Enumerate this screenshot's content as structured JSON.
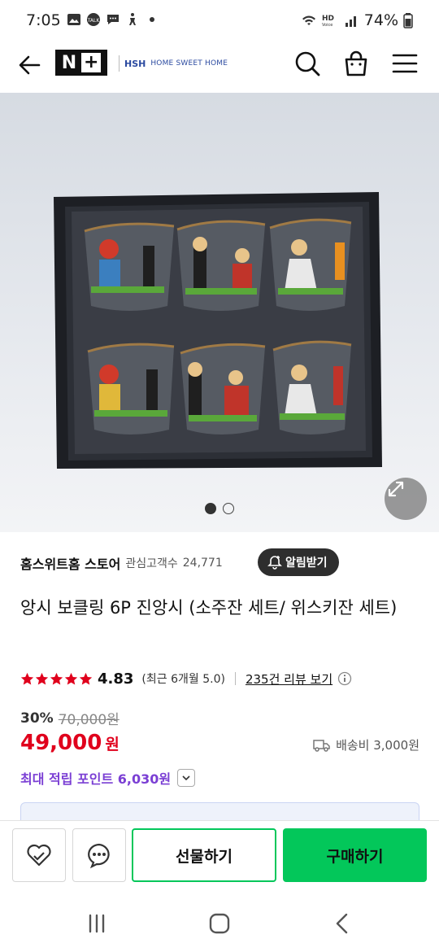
{
  "status_bar": {
    "time": "7:05",
    "battery": "74%",
    "icons": [
      "gallery-icon",
      "talk-icon",
      "accessibility-icon",
      "dot-icon",
      "wifi-icon",
      "hd-voice-icon",
      "signal-icon",
      "battery-icon"
    ]
  },
  "header": {
    "logo_n": "N",
    "logo_plus": "+",
    "store_logo_main": "HSH",
    "store_logo_sub": "HOME SWEET HOME",
    "icons": [
      "back-arrow-icon",
      "search-icon",
      "shopping-bag-icon",
      "hamburger-menu-icon"
    ]
  },
  "gallery": {
    "image_count": 2,
    "current_index": 1,
    "description_icon": "expand-icon"
  },
  "store": {
    "name": "홈스위트홈 스토어",
    "fan_label": "관심고객수",
    "fan_count": "24,771",
    "alarm_button": "알림받기"
  },
  "product": {
    "title": "앙시 보클링 6P 진앙시 (소주잔 세트/ 위스키잔 세트)",
    "star_count": 5,
    "rating": "4.83",
    "recent_rating": "(최근 6개월 5.0)",
    "review_link": "235건 리뷰 보기",
    "discount": "30%",
    "original_price": "70,000원",
    "price": "49,000",
    "price_unit": "원",
    "shipping": "배송비 3,000원",
    "points": "최대 적립 포인트 6,030원"
  },
  "actions": {
    "gift_label": "선물하기",
    "buy_label": "구매하기"
  },
  "colors": {
    "accent_green": "#03c75a",
    "price_red": "#e0001c",
    "points_purple": "#7b3fd4",
    "star_red": "#e0001c"
  }
}
